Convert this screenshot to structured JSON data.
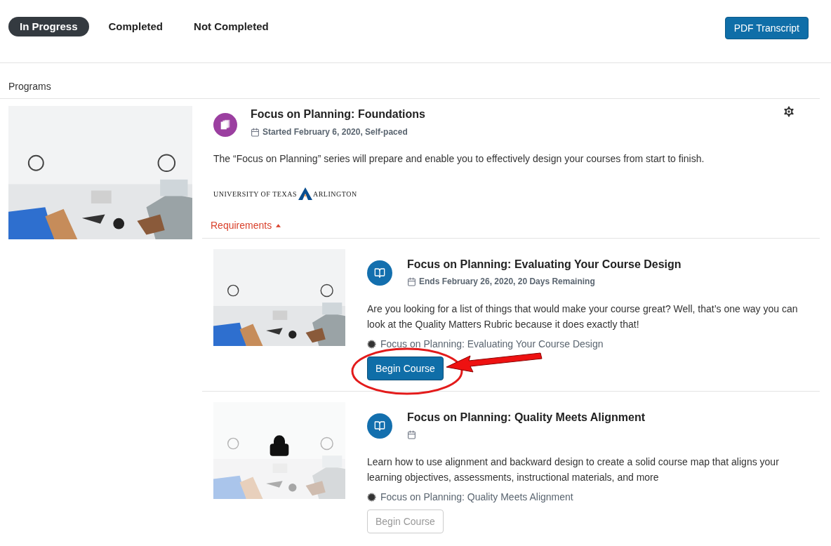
{
  "tabs": [
    {
      "label": "In Progress",
      "selected": true
    },
    {
      "label": "Completed",
      "selected": false
    },
    {
      "label": "Not Completed",
      "selected": false
    }
  ],
  "pdf_button": "PDF Transcript",
  "section_title": "Programs",
  "program": {
    "title": "Focus on Planning: Foundations",
    "date": "Started February 6, 2020, Self-paced",
    "description": "The “Focus on Planning” series will prepare and enable you to effectively design your courses from start to finish.",
    "logo": {
      "left": "UNIVERSITY OF TEXAS",
      "right": "ARLINGTON"
    },
    "requirements_label": "Requirements",
    "requirements_expanded": true,
    "courses": [
      {
        "title": "Focus on Planning: Evaluating Your Course Design",
        "date": "Ends February 26, 2020, 20 Days Remaining",
        "description": "Are you looking for a list of things that would make your course great? Well, that’s one way you can look at the Quality Matters Rubric because it does exactly that!",
        "link": "Focus on Planning: Evaluating Your Course Design",
        "button": "Begin Course",
        "locked": false
      },
      {
        "title": "Focus on Planning: Quality Meets Alignment",
        "description": "Learn how to use alignment and backward design to create a solid course map that aligns your learning objectives, assessments, instructional materials, and more",
        "link": "Focus on Planning: Quality Meets Alignment",
        "button": "Begin Course",
        "locked": true
      }
    ]
  }
}
